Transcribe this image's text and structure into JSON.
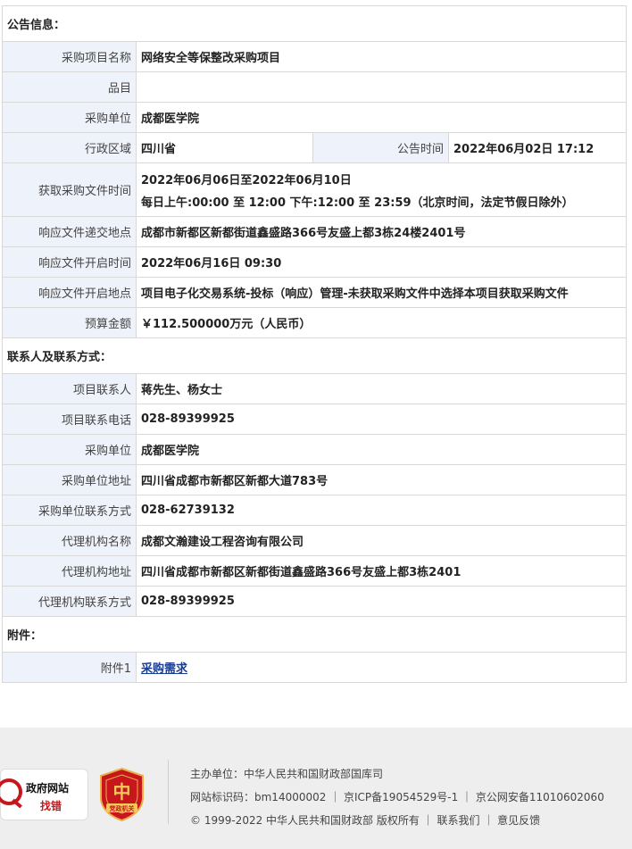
{
  "sections": {
    "notice": "公告信息：",
    "contact": "联系人及联系方式：",
    "attachment": "附件："
  },
  "notice": {
    "project_name_label": "采购项目名称",
    "project_name": "网络安全等保整改采购项目",
    "item_label": "品目",
    "item": "",
    "purchaser_label": "采购单位",
    "purchaser": "成都医学院",
    "region_label": "行政区域",
    "region": "四川省",
    "announce_time_label": "公告时间",
    "announce_time": "2022年06月02日 17:12",
    "obtain_label": "获取采购文件时间",
    "obtain_line1": "2022年06月06日至2022年06月10日",
    "obtain_line2": "每日上午:00:00 至 12:00  下午:12:00 至 23:59（北京时间，法定节假日除外）",
    "submit_place_label": "响应文件递交地点",
    "submit_place": "成都市新都区新都街道鑫盛路366号友盛上都3栋24楼2401号",
    "open_time_label": "响应文件开启时间",
    "open_time": "2022年06月16日 09:30",
    "open_place_label": "响应文件开启地点",
    "open_place": "项目电子化交易系统-投标（响应）管理-未获取采购文件中选择本项目获取采购文件",
    "budget_label": "预算金额",
    "budget": "￥112.500000万元（人民币）"
  },
  "contact": {
    "contact_person_label": "项目联系人",
    "contact_person": "蒋先生、杨女士",
    "contact_phone_label": "项目联系电话",
    "contact_phone": "028-89399925",
    "purchaser_label": "采购单位",
    "purchaser": "成都医学院",
    "purchaser_addr_label": "采购单位地址",
    "purchaser_addr": "四川省成都市新都区新都大道783号",
    "purchaser_phone_label": "采购单位联系方式",
    "purchaser_phone": "028-62739132",
    "agency_label": "代理机构名称",
    "agency": "成都文瀚建设工程咨询有限公司",
    "agency_addr_label": "代理机构地址",
    "agency_addr": "四川省成都市新都区新都街道鑫盛路366号友盛上都3栋2401",
    "agency_phone_label": "代理机构联系方式",
    "agency_phone": "028-89399925"
  },
  "attachment": {
    "label": "附件1",
    "link": "采购需求"
  },
  "footer": {
    "badge_top": "政府网站",
    "badge_bottom": "找错",
    "badge2_text": "党政机关",
    "line1": "主办单位：中华人民共和国财政部国库司",
    "line2": "网站标识码：bm14000002 ｜ 京ICP备19054529号-1 ｜ 京公网安备11010602060",
    "line3": "© 1999-2022 中华人民共和国财政部 版权所有 ｜ 联系我们 ｜ 意见反馈",
    "colors": {
      "badge_red": "#c8161d",
      "background": "#eeeeee",
      "label_bg": "#eef2fa"
    }
  }
}
